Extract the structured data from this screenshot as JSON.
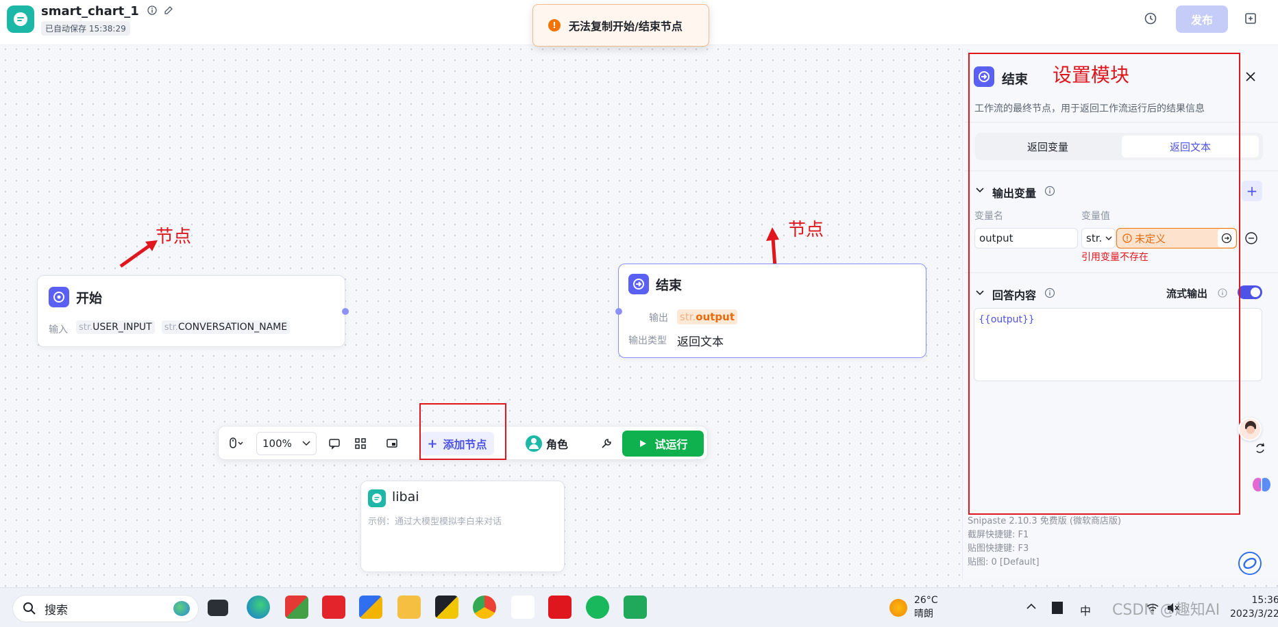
{
  "header": {
    "app_title": "smart_chart_1",
    "autosave": "已自动保存 15:38:29",
    "publish_label": "发布"
  },
  "toast": {
    "message": "无法复制开始/结束节点"
  },
  "annotations": {
    "node_left": "节点",
    "node_right": "节点",
    "panel_label": "设置模块"
  },
  "start_node": {
    "title": "开始",
    "input_label": "输入",
    "inputs": [
      {
        "type": "str.",
        "name": "USER_INPUT"
      },
      {
        "type": "str.",
        "name": "CONVERSATION_NAME"
      }
    ]
  },
  "end_node": {
    "title": "结束",
    "output_label": "输出",
    "output_type_tag": "str.",
    "output_name": "output",
    "output_type_label": "输出类型",
    "output_type_value": "返回文本"
  },
  "toolbar": {
    "zoom": "100%",
    "add_node": "添加节点",
    "role": "角色",
    "run": "试运行"
  },
  "libai_card": {
    "title": "libai",
    "desc": "示例：通过大模型模拟李白来对话"
  },
  "panel": {
    "title": "结束",
    "desc": "工作流的最终节点，用于返回工作流运行后的结果信息",
    "tabs": [
      {
        "label": "返回变量",
        "active": false
      },
      {
        "label": "返回文本",
        "active": true
      }
    ],
    "output_section": {
      "title": "输出变量",
      "col_name": "变量名",
      "col_value": "变量值",
      "var_name": "output",
      "var_type": "str.",
      "var_value": "未定义",
      "error": "引用变量不存在"
    },
    "answer_section": {
      "title": "回答内容",
      "stream_label": "流式输出",
      "stream_on": true,
      "content": "{{output}}"
    }
  },
  "snipaste": {
    "line1": "Snipaste 2.10.3 免费版 (微软商店版)",
    "line2": "截屏快捷键: F1",
    "line3": "贴图快捷键: F3",
    "line4": "贴图: 0 [Default]"
  },
  "taskbar": {
    "search_placeholder": "搜索",
    "weather_temp": "26°C",
    "weather_desc": "晴朗",
    "time": "15:36",
    "date": "2023/3/22",
    "watermark": "CSDN @趣知AI"
  },
  "colors": {
    "accent": "#4d53e8",
    "run_green": "#0fb14e",
    "warning_orange": "#f27405",
    "annotation_red": "#e0161e"
  }
}
